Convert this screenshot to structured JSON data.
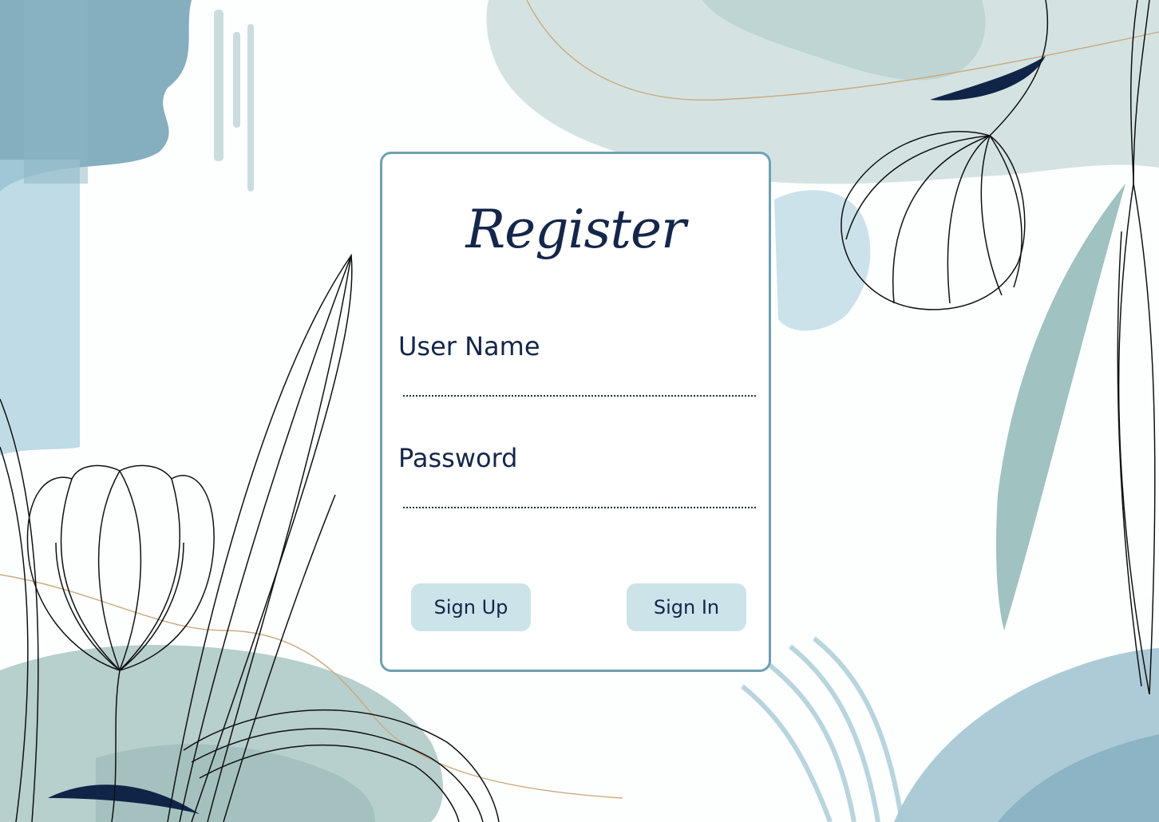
{
  "form": {
    "title": "Register",
    "username_label": "User Name",
    "username_value": "",
    "password_label": "Password",
    "password_value": "",
    "signup_label": "Sign Up",
    "signin_label": "Sign In"
  },
  "colors": {
    "accent_dark": "#14264a",
    "card_border": "#6fa0b0",
    "button_fill": "#cde3ea",
    "wash_light": "#d4e3e2",
    "wash_mid": "#a9c6c8",
    "wash_blue": "#7fb0c4"
  }
}
